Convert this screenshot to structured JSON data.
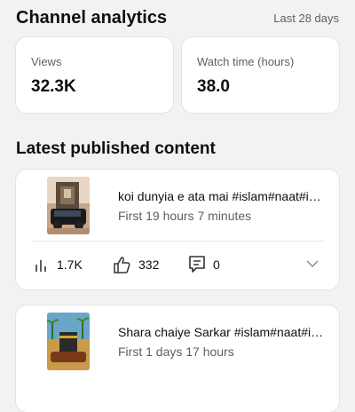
{
  "header": {
    "title": "Channel analytics",
    "range": "Last 28 days"
  },
  "stats": [
    {
      "label": "Views",
      "value": "32.3K"
    },
    {
      "label": "Watch time (hours)",
      "value": "38.0"
    }
  ],
  "latest": {
    "title": "Latest published content",
    "items": [
      {
        "title": "koi dunyia e ata mai #islam#naat#islamic #shorts",
        "subtitle": "First 19 hours 7 minutes",
        "views": "1.7K",
        "likes": "332",
        "comments": "0"
      },
      {
        "title": "Shara chaiye Sarkar #islam#naat#islamic #shorts",
        "subtitle": "First 1 days 17 hours"
      }
    ]
  },
  "icons": {
    "views": "bar-chart-icon",
    "likes": "thumbs-up-icon",
    "comments": "comment-icon",
    "expand": "chevron-down-icon"
  }
}
